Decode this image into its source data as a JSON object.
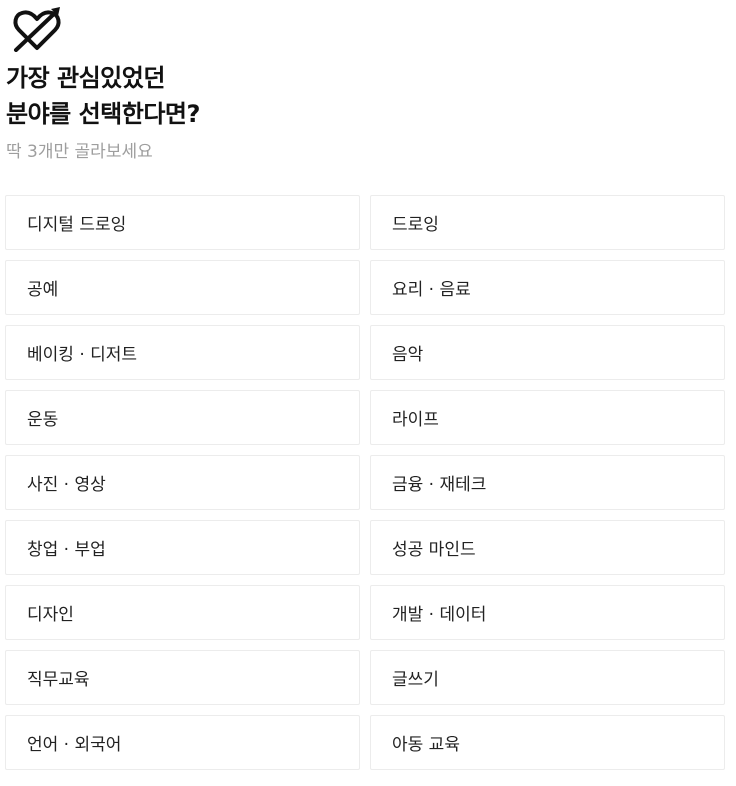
{
  "header": {
    "logo_icon": "heart-arrow-icon",
    "title_line1": "가장 관심있었던",
    "title_line2": "분야를 선택한다면?",
    "subtitle": "딱 3개만 골라보세요"
  },
  "options": [
    {
      "label": "디지털 드로잉"
    },
    {
      "label": "드로잉"
    },
    {
      "label": "공예"
    },
    {
      "label": "요리 · 음료"
    },
    {
      "label": "베이킹 · 디저트"
    },
    {
      "label": "음악"
    },
    {
      "label": "운동"
    },
    {
      "label": "라이프"
    },
    {
      "label": "사진 · 영상"
    },
    {
      "label": "금융 · 재테크"
    },
    {
      "label": "창업 · 부업"
    },
    {
      "label": "성공 마인드"
    },
    {
      "label": "디자인"
    },
    {
      "label": "개발 · 데이터"
    },
    {
      "label": "직무교육"
    },
    {
      "label": "글쓰기"
    },
    {
      "label": "언어 · 외국어"
    },
    {
      "label": "아동 교육"
    }
  ],
  "colors": {
    "border": "#ececec",
    "title": "#111111",
    "subtitle": "#9e9e9e",
    "text": "#222222"
  }
}
